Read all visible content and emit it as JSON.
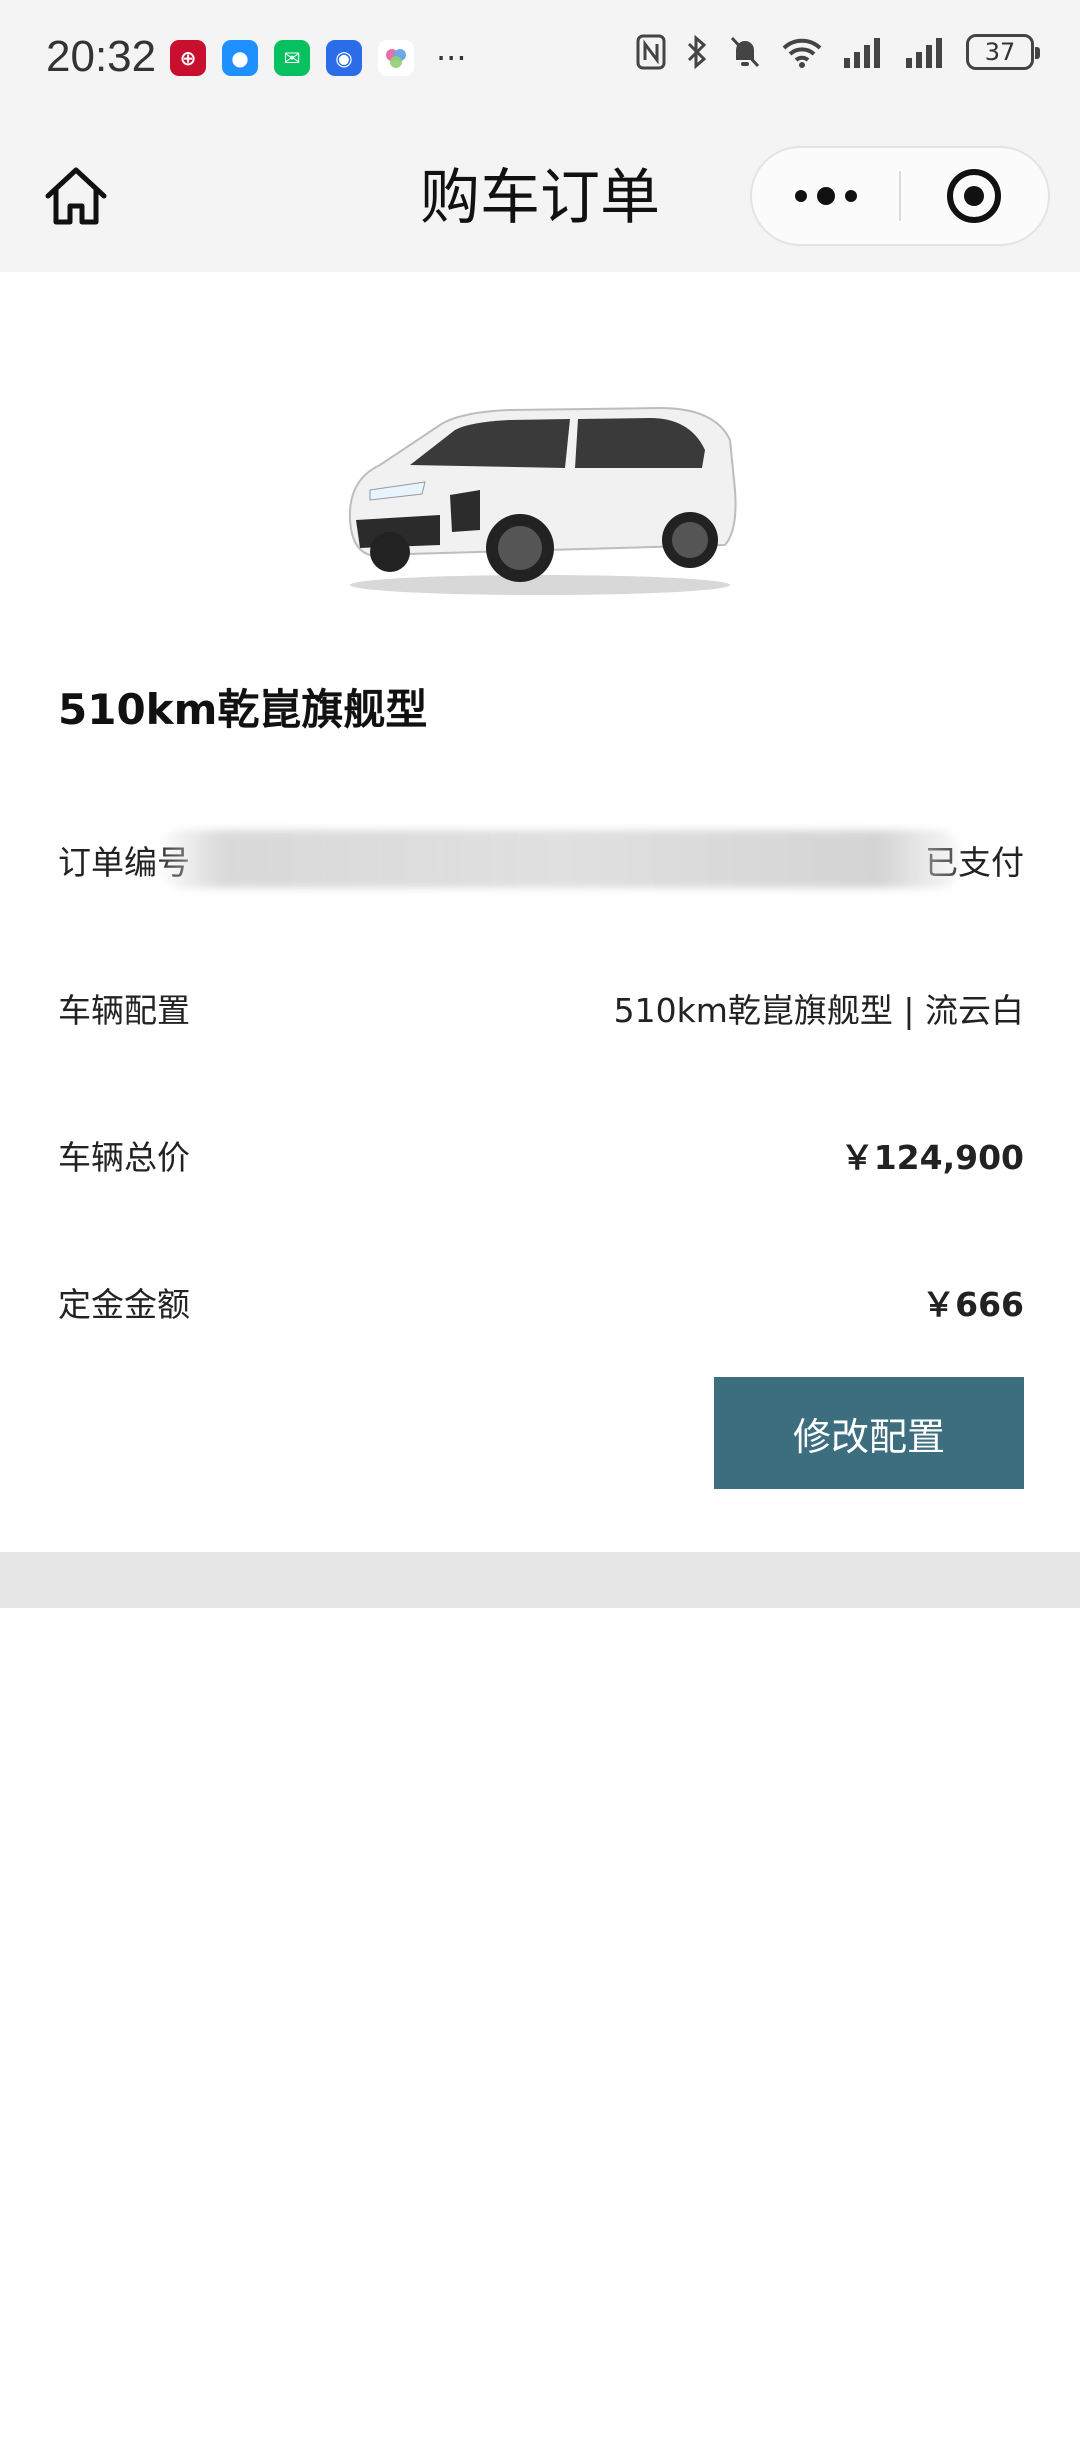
{
  "status_bar": {
    "time": "20:32",
    "battery": "37",
    "more": "···"
  },
  "nav": {
    "title": "购车订单"
  },
  "order": {
    "model_title": "510km乾崑旗舰型",
    "order_number_label": "订单编号",
    "order_status": "已支付",
    "config_label": "车辆配置",
    "config_value": "510km乾崑旗舰型 | 流云白",
    "total_label": "车辆总价",
    "total_value": "￥124,900",
    "deposit_label": "定金金额",
    "deposit_value": "￥666",
    "edit_button": "修改配置"
  },
  "colors": {
    "accent_button": "#3d6e80",
    "status_bar_bg": "#f4f4f4",
    "divider_strip": "#e6e6e6"
  }
}
